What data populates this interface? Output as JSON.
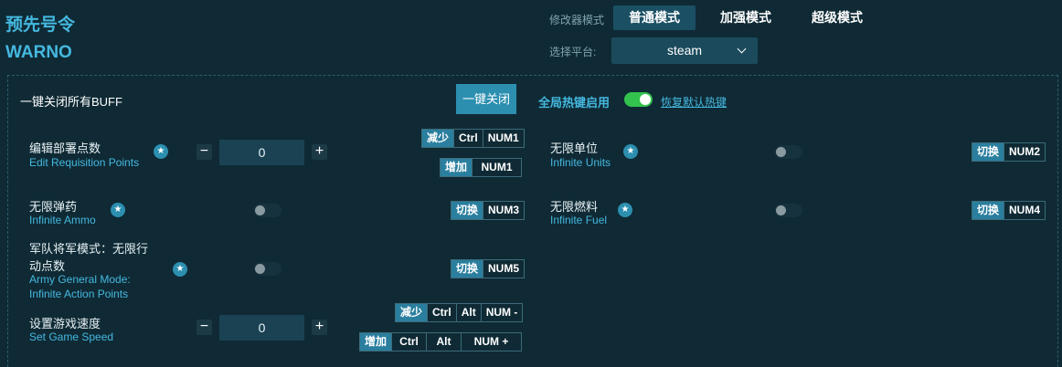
{
  "app": {
    "title_cn": "预先号令",
    "title_en": "WARNO"
  },
  "header": {
    "mode_label": "修改器模式",
    "modes": [
      {
        "label": "普通模式",
        "active": true
      },
      {
        "label": "加强模式",
        "active": false
      },
      {
        "label": "超级模式",
        "active": false
      }
    ],
    "platform_label": "选择平台:",
    "platform_value": "steam"
  },
  "toolbar": {
    "disable_all_label": "一键关闭所有BUFF",
    "disable_all_button": "一键关闭",
    "global_hotkey_label": "全局热键启用",
    "global_hotkey_on": true,
    "restore_hotkeys_link": "恢复默认热键"
  },
  "cheats": {
    "edit_requisition": {
      "label_cn": "编辑部署点数",
      "label_en": "Edit Requisition Points",
      "value": "0",
      "hotkeys": [
        {
          "action": "减少",
          "keys": [
            "Ctrl",
            "NUM1"
          ]
        },
        {
          "action": "增加",
          "keys": [
            "NUM1"
          ]
        }
      ]
    },
    "infinite_units": {
      "label_cn": "无限单位",
      "label_en": "Infinite Units",
      "on": false,
      "hotkey": {
        "action": "切换",
        "keys": [
          "NUM2"
        ]
      }
    },
    "infinite_ammo": {
      "label_cn": "无限弹药",
      "label_en": "Infinite Ammo",
      "on": false,
      "hotkey": {
        "action": "切换",
        "keys": [
          "NUM3"
        ]
      }
    },
    "infinite_fuel": {
      "label_cn": "无限燃料",
      "label_en": "Infinite Fuel",
      "on": false,
      "hotkey": {
        "action": "切换",
        "keys": [
          "NUM4"
        ]
      }
    },
    "army_general": {
      "label_cn_line1": "军队将军模式：无限行",
      "label_cn_line2": "动点数",
      "label_en_line1": "Army General Mode:",
      "label_en_line2": "Infinite Action Points",
      "on": false,
      "hotkey": {
        "action": "切换",
        "keys": [
          "NUM5"
        ]
      }
    },
    "game_speed": {
      "label_cn": "设置游戏速度",
      "label_en": "Set Game Speed",
      "value": "0",
      "hotkeys": [
        {
          "action": "减少",
          "keys": [
            "Ctrl",
            "Alt",
            "NUM -"
          ]
        },
        {
          "action": "增加",
          "keys": [
            "Ctrl",
            "Alt",
            "NUM +"
          ]
        }
      ]
    }
  },
  "icons": {
    "star": "star-icon",
    "minus": "minus-icon",
    "plus": "plus-icon",
    "chevron": "chevron-down-icon"
  },
  "colors": {
    "background": "#0f2a35",
    "accent": "#45b8df",
    "button": "#2c8fb0",
    "toggle_on": "#32c24d"
  }
}
